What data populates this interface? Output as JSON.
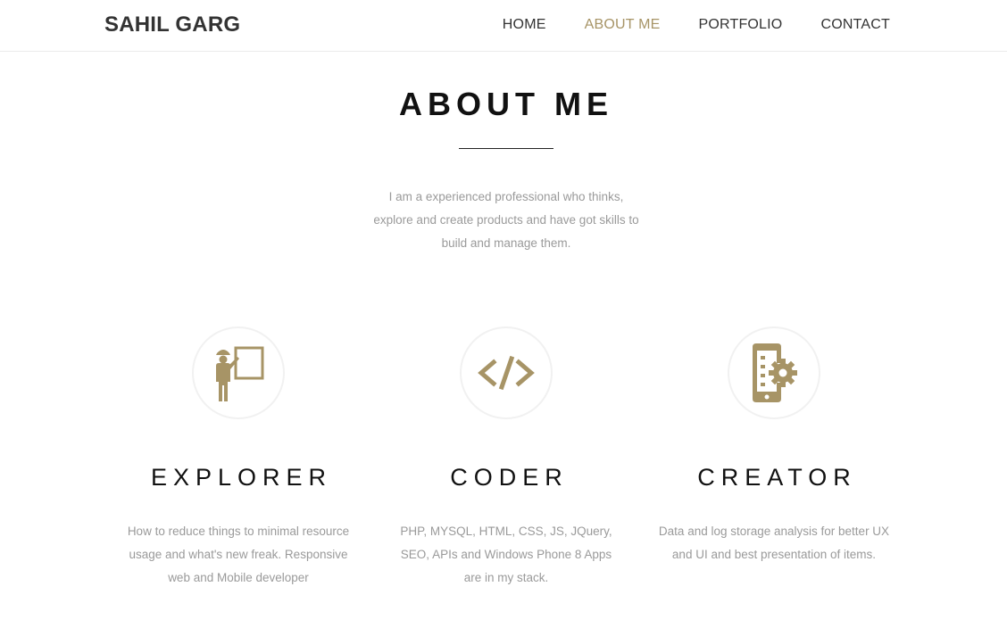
{
  "header": {
    "brand": "SAHIL GARG",
    "nav": [
      {
        "label": "HOME"
      },
      {
        "label": "ABOUT ME",
        "active": true
      },
      {
        "label": "PORTFOLIO"
      },
      {
        "label": "CONTACT"
      }
    ]
  },
  "about": {
    "title": "ABOUT ME",
    "intro": "I am a experienced professional who thinks, explore and create products and have got skills to build and manage them."
  },
  "features": [
    {
      "icon": "presenter-icon",
      "title": "EXPLORER",
      "text": "How to reduce things to minimal resource usage and what's new freak. Responsive web and Mobile developer"
    },
    {
      "icon": "code-icon",
      "title": "CODER",
      "text": "PHP, MYSQL, HTML, CSS, JS, JQuery, SEO, APIs and Windows Phone 8 Apps are in my stack."
    },
    {
      "icon": "mobile-settings-icon",
      "title": "CREATOR",
      "text": "Data and log storage analysis for better UX and UI and best presentation of items."
    }
  ],
  "colors": {
    "accent": "#a79466",
    "heading": "#111111",
    "body_text": "#9a9a9a",
    "nav_text": "#333333"
  }
}
